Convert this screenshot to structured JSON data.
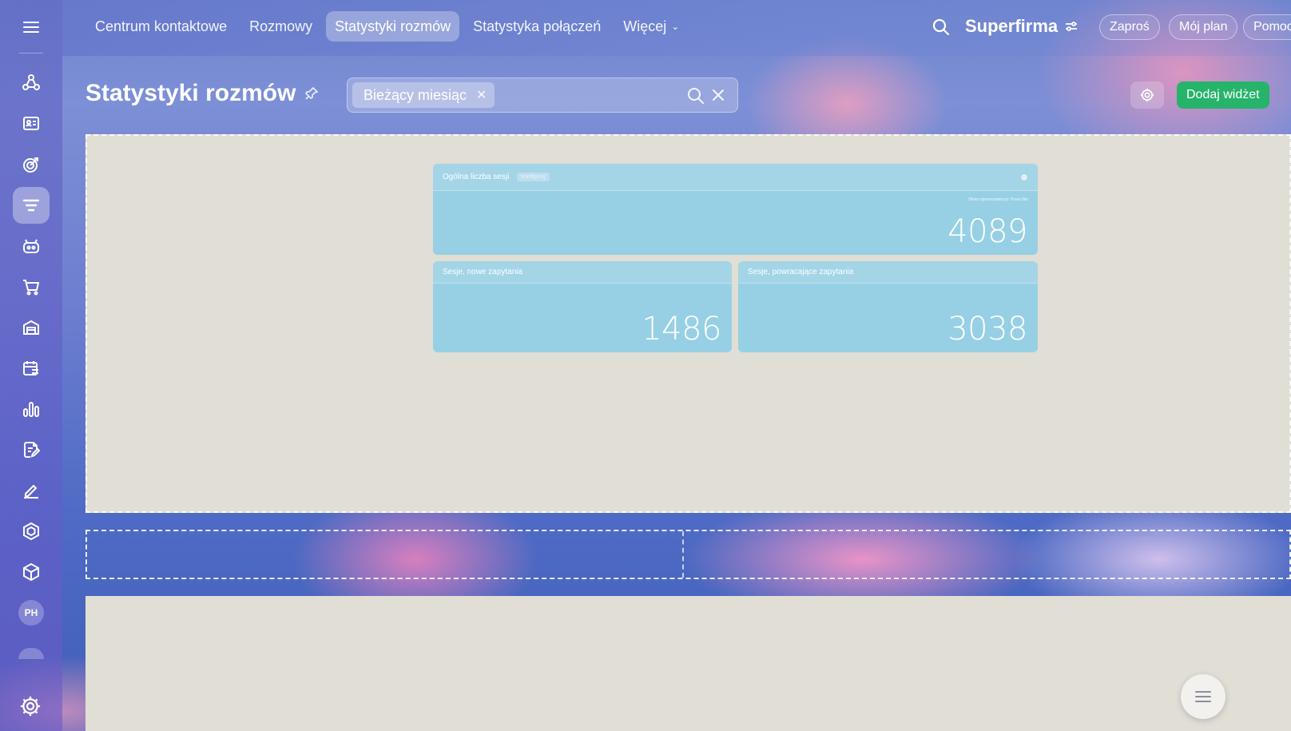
{
  "sidebar": {
    "avatar_initials": "PH",
    "items": [
      {
        "icon": "crm-nodes-icon"
      },
      {
        "icon": "contact-center-icon"
      },
      {
        "icon": "target-icon"
      },
      {
        "icon": "funnel-filter-icon",
        "active": true
      },
      {
        "icon": "bot-icon"
      },
      {
        "icon": "shopping-cart-icon"
      },
      {
        "icon": "warehouse-icon"
      },
      {
        "icon": "calendar-list-icon"
      },
      {
        "icon": "bar-chart-icon"
      },
      {
        "icon": "document-edit-icon"
      },
      {
        "icon": "pen-signature-icon"
      },
      {
        "icon": "hexagon-icon"
      },
      {
        "icon": "box-package-icon"
      }
    ]
  },
  "topnav": {
    "items": [
      "Centrum kontaktowe",
      "Rozmowy",
      "Statystyki rozmów",
      "Statystyka połączeń",
      "Więcej"
    ],
    "active_index": 2
  },
  "brand": {
    "name": "Superfirma"
  },
  "top_buttons": {
    "invite": "Zaproś",
    "plan": "Mój plan",
    "help": "Pomoc"
  },
  "page": {
    "title": "Statystyki rozmów"
  },
  "filter": {
    "chip": "Bieżący miesiąc"
  },
  "actions": {
    "add_widget": "Dodaj widżet"
  },
  "widgets": {
    "total": {
      "title": "Ogólna liczba sesji",
      "badge": "konfiguruj",
      "note": "Okres sprawozdawczy: Przez film",
      "value": "4089"
    },
    "new": {
      "title": "Sesje, nowe zapytania",
      "value": "1486"
    },
    "returning": {
      "title": "Sesje, powracające zapytania",
      "value": "3038"
    }
  },
  "colors": {
    "accent_green": "#26b36a",
    "widget_bg": "#97d0e4",
    "board_bg": "#e0ded5"
  }
}
